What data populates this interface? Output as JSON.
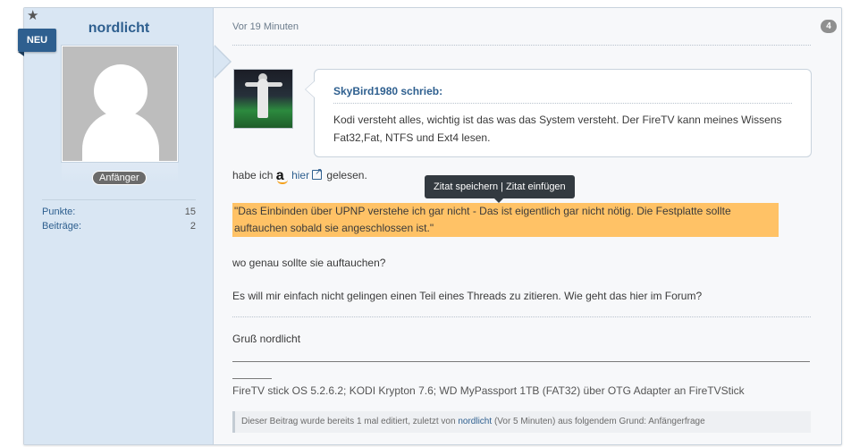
{
  "author": {
    "username": "nordlicht",
    "new_badge": "NEU",
    "rank": "Anfänger",
    "stats": [
      {
        "label": "Punkte:",
        "value": "15"
      },
      {
        "label": "Beiträge:",
        "value": "2"
      }
    ]
  },
  "post": {
    "time": "Vor 19 Minuten",
    "number": "4",
    "quote": {
      "author": "SkyBird1980 schrieb:",
      "text": "Kodi versteht alles, wichtig ist das was das System versteht. Der FireTV kann meines Wissens Fat32,Fat, NTFS und Ext4 lesen."
    },
    "line1_prefix": "habe ich",
    "line1_link": "hier",
    "line1_suffix": "gelesen.",
    "highlighted": "\"Das Einbinden über UPNP verstehe ich gar nicht - Das ist eigentlich gar nicht nötig. Die Festplatte sollte auftauchen sobald sie angeschlossen ist.\"",
    "line2": "wo genau sollte sie auftauchen?",
    "line3": "Es will mir einfach nicht gelingen einen Teil eines Threads zu zitieren. Wie geht das hier im Forum?",
    "greeting": "Gruß nordlicht",
    "signature": "FireTV stick OS 5.2.6.2; KODI Krypton 7.6; WD MyPassport 1TB (FAT32) über OTG Adapter an FireTVStick",
    "edit_prefix": "Dieser Beitrag wurde bereits 1 mal editiert, zuletzt von",
    "edit_user": "nordlicht",
    "edit_suffix": "(Vor 5 Minuten) aus folgendem Grund: Anfängerfrage"
  },
  "tooltip": {
    "save": "Zitat speichern",
    "separator": "|",
    "insert": "Zitat einfügen"
  }
}
